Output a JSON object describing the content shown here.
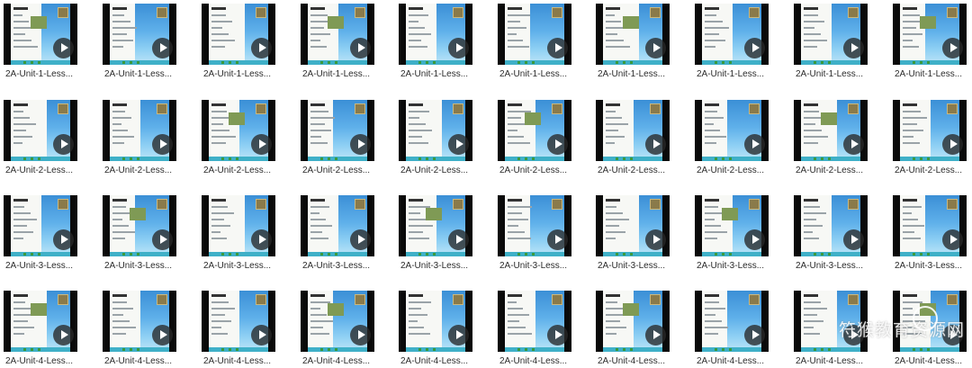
{
  "rows": [
    {
      "name": "unit-1",
      "items": [
        "2A-Unit-1-Less...",
        "2A-Unit-1-Less...",
        "2A-Unit-1-Less...",
        "2A-Unit-1-Less...",
        "2A-Unit-1-Less...",
        "2A-Unit-1-Less...",
        "2A-Unit-1-Less...",
        "2A-Unit-1-Less...",
        "2A-Unit-1-Less...",
        "2A-Unit-1-Less..."
      ]
    },
    {
      "name": "unit-2",
      "items": [
        "2A-Unit-2-Less...",
        "2A-Unit-2-Less...",
        "2A-Unit-2-Less...",
        "2A-Unit-2-Less...",
        "2A-Unit-2-Less...",
        "2A-Unit-2-Less...",
        "2A-Unit-2-Less...",
        "2A-Unit-2-Less...",
        "2A-Unit-2-Less...",
        "2A-Unit-2-Less..."
      ]
    },
    {
      "name": "unit-3",
      "items": [
        "2A-Unit-3-Less...",
        "2A-Unit-3-Less...",
        "2A-Unit-3-Less...",
        "2A-Unit-3-Less...",
        "2A-Unit-3-Less...",
        "2A-Unit-3-Less...",
        "2A-Unit-3-Less...",
        "2A-Unit-3-Less...",
        "2A-Unit-3-Less...",
        "2A-Unit-3-Less..."
      ]
    },
    {
      "name": "unit-4",
      "items": [
        "2A-Unit-4-Less...",
        "2A-Unit-4-Less...",
        "2A-Unit-4-Less...",
        "2A-Unit-4-Less...",
        "2A-Unit-4-Less...",
        "2A-Unit-4-Less...",
        "2A-Unit-4-Less...",
        "2A-Unit-4-Less...",
        "2A-Unit-4-Less...",
        "2A-Unit-4-Less..."
      ]
    }
  ],
  "watermark": {
    "text": "符猴教育资源网"
  },
  "icons": {
    "play": "play-icon",
    "thumbnail": "video-thumbnail"
  }
}
